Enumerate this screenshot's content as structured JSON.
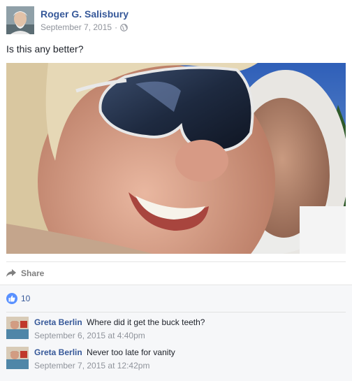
{
  "post": {
    "author": "Roger G. Salisbury",
    "date": "September 7, 2015",
    "separator": "·",
    "privacy_icon": "globe-icon",
    "text": "Is this any better?"
  },
  "actions": {
    "share_label": "Share",
    "share_icon": "share-arrow-icon"
  },
  "reactions": {
    "like_icon": "thumbs-up-icon",
    "count": "10"
  },
  "comments": [
    {
      "author": "Greta Berlin",
      "text": "Where did it get the buck teeth?",
      "time": "September 6, 2015 at 4:40pm"
    },
    {
      "author": "Greta Berlin",
      "text": "Never too late for vanity",
      "time": "September 7, 2015 at 12:42pm"
    }
  ],
  "colors": {
    "link": "#365899",
    "meta": "#90949c",
    "like": "#5890ff",
    "footer_bg": "#f6f7f9"
  }
}
